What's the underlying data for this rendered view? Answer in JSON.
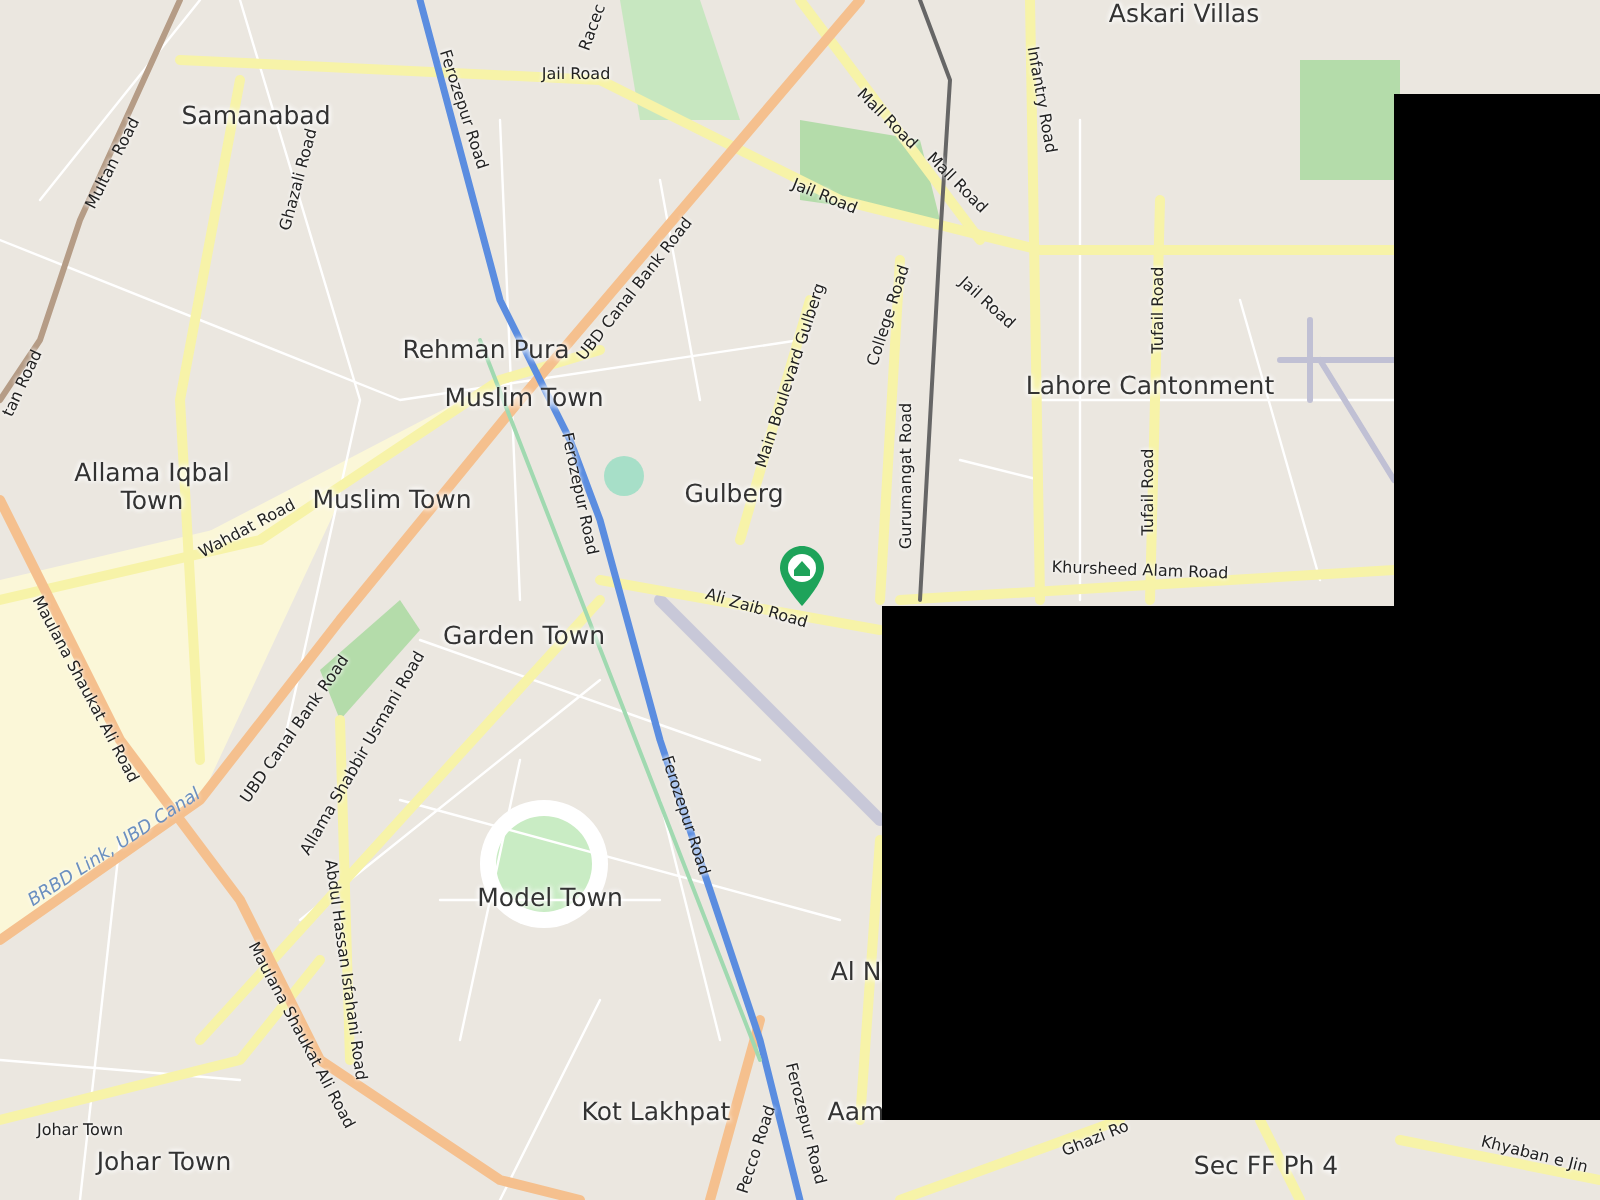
{
  "map": {
    "places": [
      {
        "label": "Askari Villas"
      },
      {
        "label": "Samanabad"
      },
      {
        "label": "Rehman Pura"
      },
      {
        "label": "Muslim Town"
      },
      {
        "label": "Lahore Cantonment"
      },
      {
        "label": "Allama Iqbal Town"
      },
      {
        "label": "Muslim Town"
      },
      {
        "label": "Gulberg"
      },
      {
        "label": "Garden Town"
      },
      {
        "label": "Model Town"
      },
      {
        "label": "Al N"
      },
      {
        "label": "Aam"
      },
      {
        "label": "Kot Lakhpat"
      },
      {
        "label": "Johar Town"
      },
      {
        "label": "Sec FF Ph 4"
      }
    ],
    "road_labels": [
      {
        "label": "Racec",
        "kind": "road"
      },
      {
        "label": "Jail Road",
        "kind": "road"
      },
      {
        "label": "Ferozepur Road",
        "kind": "road"
      },
      {
        "label": "Multan Road",
        "kind": "road"
      },
      {
        "label": "Ghazali Road",
        "kind": "road"
      },
      {
        "label": "Mall Road",
        "kind": "road"
      },
      {
        "label": "Mall Road",
        "kind": "road"
      },
      {
        "label": "Infantry Road",
        "kind": "road"
      },
      {
        "label": "Jail Road",
        "kind": "road"
      },
      {
        "label": "Jail Road",
        "kind": "road"
      },
      {
        "label": "College Road",
        "kind": "road"
      },
      {
        "label": "UBD Canal Bank Road",
        "kind": "road"
      },
      {
        "label": "tan Road",
        "kind": "road"
      },
      {
        "label": "Main Boulevard Gulberg",
        "kind": "road"
      },
      {
        "label": "Tufail Road",
        "kind": "road"
      },
      {
        "label": "Gurumangat Road",
        "kind": "road"
      },
      {
        "label": "Ferozepur Road",
        "kind": "road"
      },
      {
        "label": "Wahdat Road",
        "kind": "road"
      },
      {
        "label": "Tufail Road",
        "kind": "road"
      },
      {
        "label": "Khursheed Alam Road",
        "kind": "road"
      },
      {
        "label": "Ali Zaib Road",
        "kind": "road"
      },
      {
        "label": "UBD Canal Bank Road",
        "kind": "road"
      },
      {
        "label": "Allama Shabbir Usmani Road",
        "kind": "road"
      },
      {
        "label": "Maulana Shaukat Ali Road",
        "kind": "road"
      },
      {
        "label": "BRBD Link, UBD Canal",
        "kind": "waterway"
      },
      {
        "label": "Ferozepur Road",
        "kind": "road"
      },
      {
        "label": "Abdul Hassan Isfahani Road",
        "kind": "road"
      },
      {
        "label": "Maulana Shaukat Ali Road",
        "kind": "road"
      },
      {
        "label": "Johar Town",
        "kind": "road"
      },
      {
        "label": "Pecco Road",
        "kind": "road"
      },
      {
        "label": "Ferozepur Road",
        "kind": "road"
      },
      {
        "label": "Ghazi Ro",
        "kind": "road"
      },
      {
        "label": "Khyaban e Jin",
        "kind": "road"
      }
    ]
  }
}
